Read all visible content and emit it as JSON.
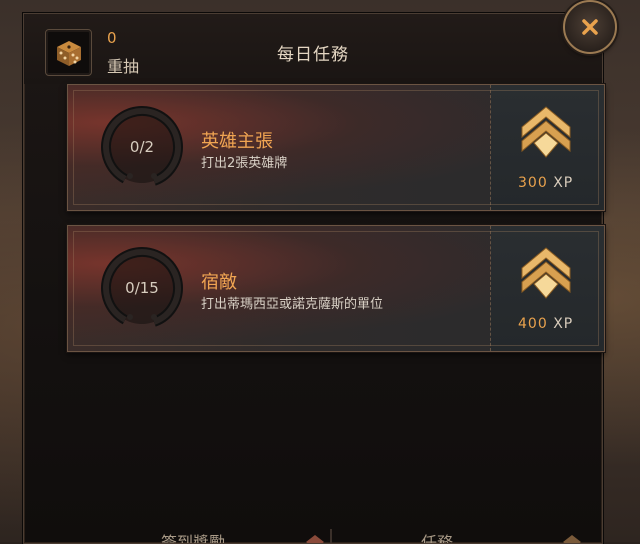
{
  "header": {
    "reroll_count": "0",
    "reroll_label": "重抽",
    "title": "每日任務"
  },
  "quests": [
    {
      "progress": "0/2",
      "progress_fraction": 0,
      "title": "英雄主張",
      "description": "打出2張英雄牌",
      "xp_value": "300",
      "xp_unit": "XP"
    },
    {
      "progress": "0/15",
      "progress_fraction": 0,
      "title": "宿敵",
      "description": "打出蒂瑪西亞或諾克薩斯的單位",
      "xp_value": "400",
      "xp_unit": "XP"
    }
  ],
  "bottom_tabs": {
    "left_label": "簽到獎勵",
    "right_label": "任務"
  },
  "colors": {
    "accent_gold": "#e9a24d",
    "title_text": "#e4d6c2",
    "panel_bg": "#141110"
  },
  "icons": {
    "reroll": "dice-icon",
    "close": "close-icon",
    "reward": "chevron-rank-icon"
  }
}
